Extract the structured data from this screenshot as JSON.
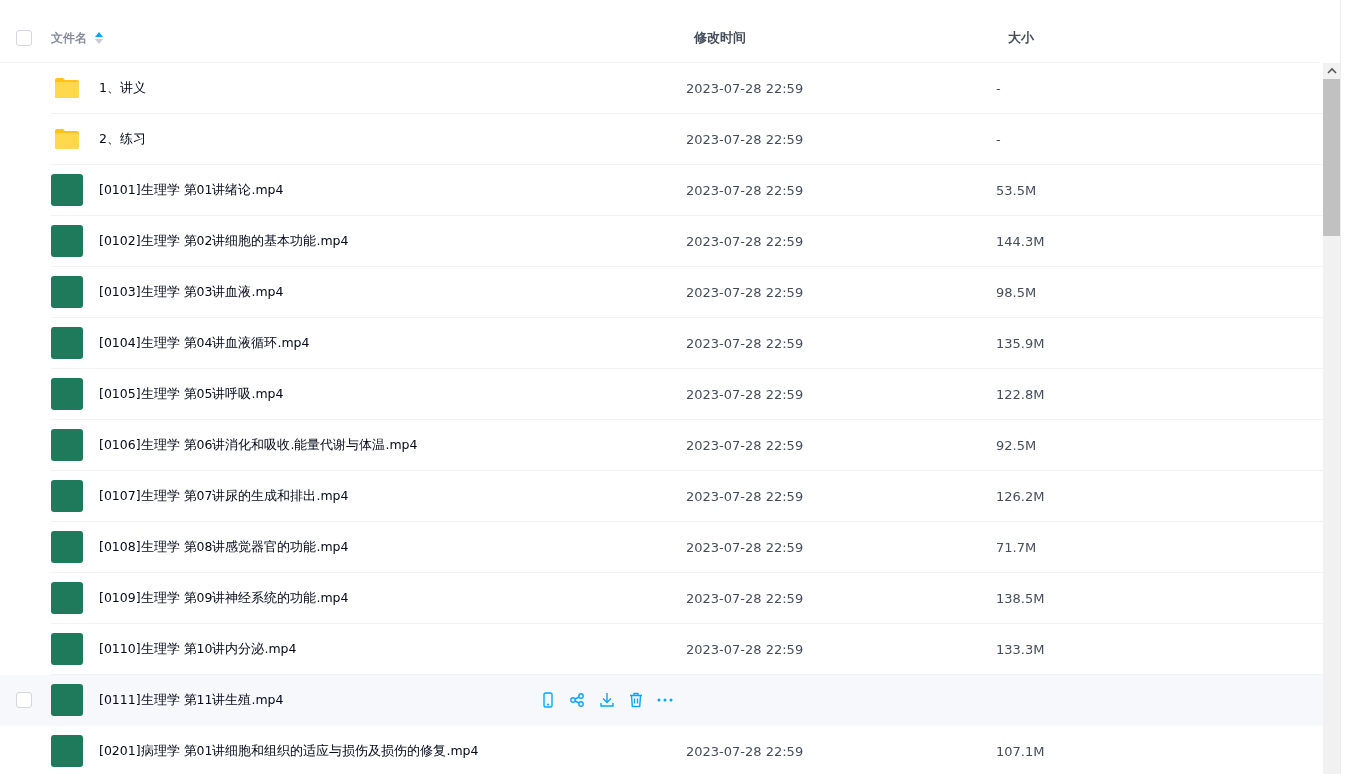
{
  "table": {
    "columns": [
      {
        "label": "文件名",
        "sort_ascending": true
      },
      {
        "label": "修改时间"
      },
      {
        "label": "大小"
      }
    ],
    "header_checked": false,
    "rows": [
      {
        "kind": "folder",
        "name": "1、讲义",
        "modified": "2023-07-28 22:59",
        "size": "-",
        "hovered": false
      },
      {
        "kind": "folder",
        "name": "2、练习",
        "modified": "2023-07-28 22:59",
        "size": "-",
        "hovered": false
      },
      {
        "kind": "video",
        "name": "[0101]生理学 第01讲绪论.mp4",
        "modified": "2023-07-28 22:59",
        "size": "53.5M",
        "hovered": false
      },
      {
        "kind": "video",
        "name": "[0102]生理学 第02讲细胞的基本功能.mp4",
        "modified": "2023-07-28 22:59",
        "size": "144.3M",
        "hovered": false
      },
      {
        "kind": "video",
        "name": "[0103]生理学 第03讲血液.mp4",
        "modified": "2023-07-28 22:59",
        "size": "98.5M",
        "hovered": false
      },
      {
        "kind": "video",
        "name": "[0104]生理学 第04讲血液循环.mp4",
        "modified": "2023-07-28 22:59",
        "size": "135.9M",
        "hovered": false
      },
      {
        "kind": "video",
        "name": "[0105]生理学 第05讲呼吸.mp4",
        "modified": "2023-07-28 22:59",
        "size": "122.8M",
        "hovered": false
      },
      {
        "kind": "video",
        "name": "[0106]生理学 第06讲消化和吸收.能量代谢与体温.mp4",
        "modified": "2023-07-28 22:59",
        "size": "92.5M",
        "hovered": false
      },
      {
        "kind": "video",
        "name": "[0107]生理学 第07讲尿的生成和排出.mp4",
        "modified": "2023-07-28 22:59",
        "size": "126.2M",
        "hovered": false
      },
      {
        "kind": "video",
        "name": "[0108]生理学 第08讲感觉器官的功能.mp4",
        "modified": "2023-07-28 22:59",
        "size": "71.7M",
        "hovered": false
      },
      {
        "kind": "video",
        "name": "[0109]生理学 第09讲神经系统的功能.mp4",
        "modified": "2023-07-28 22:59",
        "size": "138.5M",
        "hovered": false
      },
      {
        "kind": "video",
        "name": "[0110]生理学 第10讲内分泌.mp4",
        "modified": "2023-07-28 22:59",
        "size": "133.3M",
        "hovered": false
      },
      {
        "kind": "video",
        "name": "[0111]生理学 第11讲生殖.mp4",
        "hovered": true,
        "checked": false
      },
      {
        "kind": "video",
        "name": "[0201]病理学 第01讲细胞和组织的适应与损伤及损伤的修复.mp4",
        "modified": "2023-07-28 22:59",
        "size": "107.1M",
        "hovered": false
      }
    ]
  }
}
